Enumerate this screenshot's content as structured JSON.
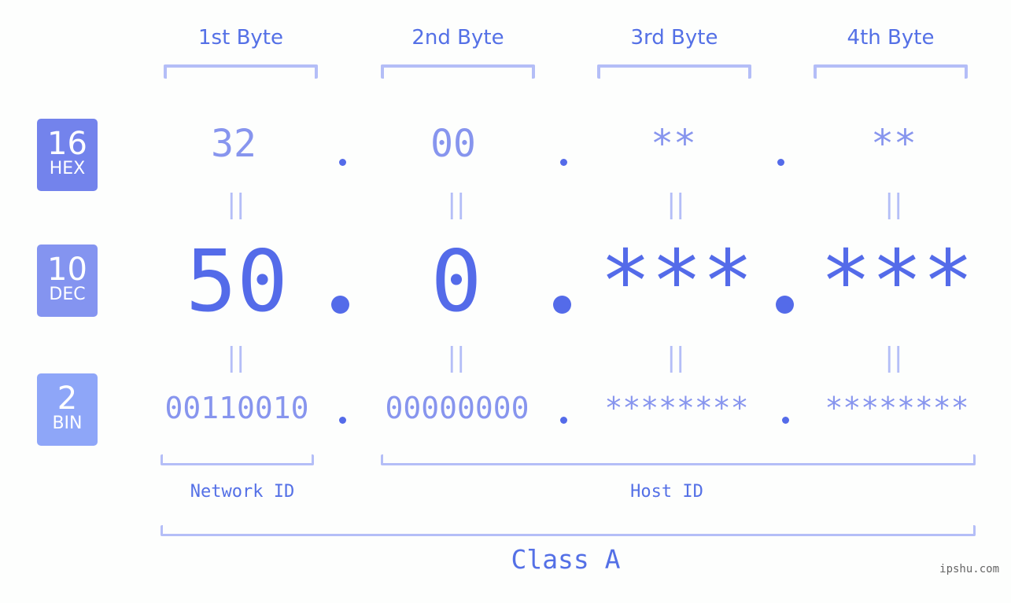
{
  "bytes": [
    {
      "header": "1st Byte",
      "hex": "32",
      "dec": "50",
      "bin": "00110010"
    },
    {
      "header": "2nd Byte",
      "hex": "00",
      "dec": "0",
      "bin": "00000000"
    },
    {
      "header": "3rd Byte",
      "hex": "**",
      "dec": "***",
      "bin": "********"
    },
    {
      "header": "4th Byte",
      "hex": "**",
      "dec": "***",
      "bin": "********"
    }
  ],
  "bases": [
    {
      "num": "16",
      "label": "HEX",
      "color": "#7383ec"
    },
    {
      "num": "10",
      "label": "DEC",
      "color": "#8494f0"
    },
    {
      "num": "2",
      "label": "BIN",
      "color": "#8ea6f8"
    }
  ],
  "equals": "||",
  "network_label": "Network ID",
  "host_label": "Host ID",
  "class_label": "Class A",
  "watermark": "ipshu.com",
  "colors": {
    "accent": "#546be9",
    "light": "#8795ee",
    "bracket": "#b4bef7"
  }
}
